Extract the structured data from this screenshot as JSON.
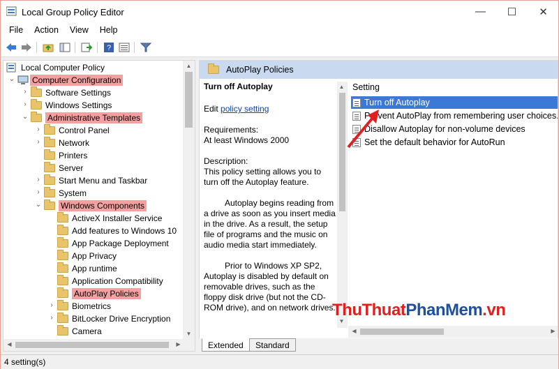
{
  "window": {
    "title": "Local Group Policy Editor",
    "minimize": "—",
    "maximize": "☐",
    "close": "✕"
  },
  "menu": [
    "File",
    "Action",
    "View",
    "Help"
  ],
  "tree": {
    "root": "Local Computer Policy",
    "computer_configuration": "Computer Configuration",
    "software_settings": "Software Settings",
    "windows_settings": "Windows Settings",
    "administrative_templates": "Administrative Templates",
    "control_panel": "Control Panel",
    "network": "Network",
    "printers": "Printers",
    "server": "Server",
    "start_menu": "Start Menu and Taskbar",
    "system": "System",
    "windows_components": "Windows Components",
    "activex": "ActiveX Installer Service",
    "add_features": "Add features to Windows 10",
    "app_package": "App Package Deployment",
    "app_privacy": "App Privacy",
    "app_runtime": "App runtime",
    "app_compat": "Application Compatibility",
    "autoplay": "AutoPlay Policies",
    "biometrics": "Biometrics",
    "bitlocker": "BitLocker Drive Encryption",
    "camera": "Camera"
  },
  "right": {
    "header": "AutoPlay Policies",
    "policy_title": "Turn off Autoplay",
    "edit_prefix": "Edit ",
    "edit_link": "policy setting",
    "requirements_label": "Requirements:",
    "requirements_value": "At least Windows 2000",
    "description_label": "Description:",
    "description_1": "This policy setting allows you to turn off the Autoplay feature.",
    "description_2": "Autoplay begins reading from a drive as soon as you insert media in the drive. As a result, the setup file of programs and the music on audio media start immediately.",
    "description_3": "Prior to Windows XP SP2, Autoplay is disabled by default on removable drives, such as the floppy disk drive (but not the CD-ROM drive), and on network drives.",
    "setting_header": "Setting",
    "settings": [
      "Turn off Autoplay",
      "Prevent AutoPlay from remembering user choices.",
      "Disallow Autoplay for non-volume devices",
      "Set the default behavior for AutoRun"
    ]
  },
  "tabs": {
    "extended": "Extended",
    "standard": "Standard"
  },
  "status": "4 setting(s)",
  "watermark": {
    "part1": "ThuThuat",
    "part2": "PhanMem",
    "part3": ".vn"
  },
  "colors": {
    "highlight": "#f4a0a0",
    "selection": "#3b79d6",
    "header_bg": "#c9daf0"
  }
}
